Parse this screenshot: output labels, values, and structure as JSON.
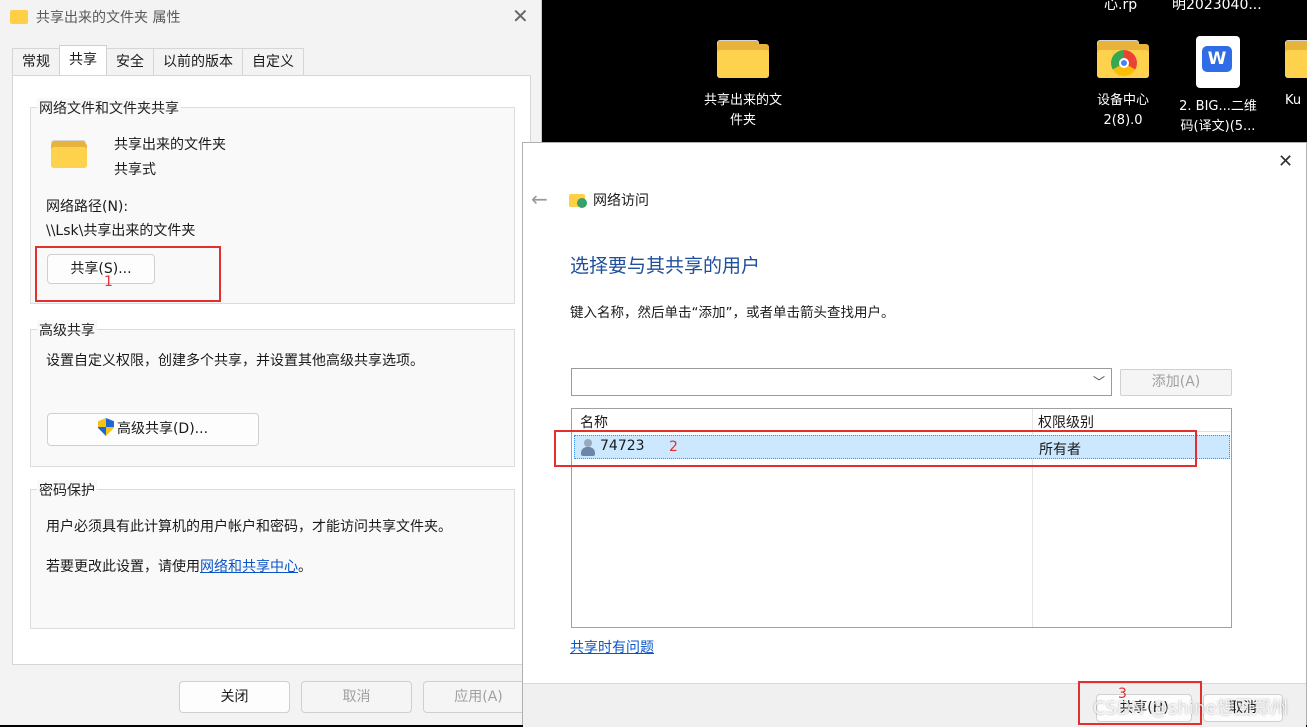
{
  "desktop": {
    "partial_top_1": "心.rp",
    "partial_top_2": "明2023040...",
    "icons": [
      {
        "label": "共享出来的文\n件夹",
        "icon": "folder-icon"
      },
      {
        "label": "设备中心\n2(8).0",
        "icon": "chrome-folder-icon"
      },
      {
        "label": "2. BIG...二维\n码(译文)(5...",
        "icon": "wps-doc-icon"
      },
      {
        "label": "Ku",
        "icon": "folder-icon"
      }
    ]
  },
  "props": {
    "title": "共享出来的文件夹 属性",
    "tabs": [
      "常规",
      "共享",
      "安全",
      "以前的版本",
      "自定义"
    ],
    "active_tab": "共享",
    "network_sharing": {
      "group_title": "网络文件和文件夹共享",
      "folder_name": "共享出来的文件夹",
      "folder_status": "共享式",
      "path_label": "网络路径(N):",
      "path_value": "\\\\Lsk\\共享出来的文件夹",
      "share_button": "共享(S)..."
    },
    "advanced": {
      "group_title": "高级共享",
      "description": "设置自定义权限，创建多个共享，并设置其他高级共享选项。",
      "button": "高级共享(D)..."
    },
    "password": {
      "group_title": "密码保护",
      "line1": "用户必须具有此计算机的用户帐户和密码，才能访问共享文件夹。",
      "line2_prefix": "若要更改此设置，请使用",
      "line2_link": "网络和共享中心",
      "line2_suffix": "。"
    },
    "footer": {
      "close": "关闭",
      "cancel": "取消",
      "apply": "应用(A)"
    }
  },
  "net_dialog": {
    "title": "网络访问",
    "heading": "选择要与其共享的用户",
    "instruction": "键入名称，然后单击“添加”，或者单击箭头查找用户。",
    "add_button": "添加(A)",
    "columns": [
      "名称",
      "权限级别"
    ],
    "users": [
      {
        "name": "74723",
        "permission": "所有者"
      }
    ],
    "trouble_link": "共享时有问题",
    "share_button": "共享(H)",
    "cancel_button": "取消"
  },
  "annotations": [
    "1",
    "2",
    "3"
  ],
  "watermark": "CSDN @shine想回郑州"
}
